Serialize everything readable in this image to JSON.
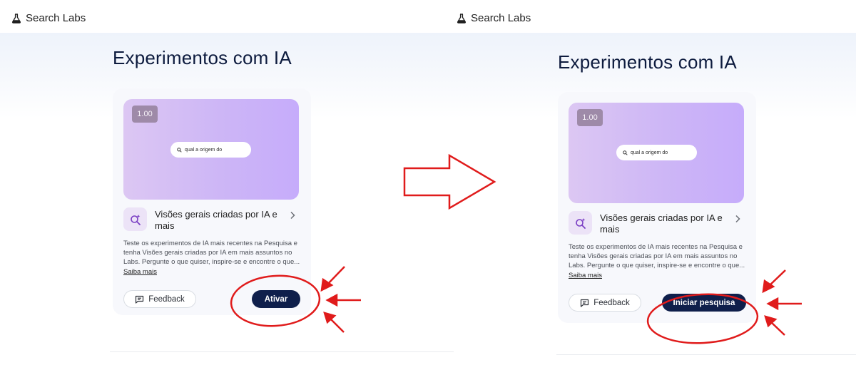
{
  "left_panel": {
    "brand": "Search Labs",
    "page_title": "Experimentos com IA",
    "card": {
      "version_badge": "1.00",
      "search_preview": "qual a origem do",
      "feature_title": "Visões gerais criadas por IA e mais",
      "description": "Teste os experimentos de IA mais recentes na Pesquisa e tenha Visões gerais criadas por IA em mais assuntos no Labs. Pergunte o que quiser, inspire-se e encontre o que...",
      "learn_more": "Saiba mais",
      "feedback_label": "Feedback",
      "action_label": "Ativar"
    }
  },
  "right_panel": {
    "brand": "Search Labs",
    "page_title": "Experimentos com IA",
    "card": {
      "version_badge": "1.00",
      "search_preview": "qual a origem do",
      "feature_title": "Visões gerais criadas por IA e mais",
      "description": "Teste os experimentos de IA mais recentes na Pesquisa e tenha Visões gerais criadas por IA em mais assuntos no Labs. Pergunte o que quiser, inspire-se e encontre o que...",
      "learn_more": "Saiba mais",
      "feedback_label": "Feedback",
      "action_label": "Iniciar pesquisa"
    }
  },
  "colors": {
    "primary_button": "#0f1f4b",
    "annotation": "#e01b1b",
    "hero_gradient_start": "#dcc7f3",
    "hero_gradient_end": "#c6acfb"
  },
  "icons": [
    "flask-icon",
    "search-icon",
    "sparkle-search-icon",
    "chevron-right-icon",
    "feedback-icon",
    "arrow-right-icon"
  ]
}
